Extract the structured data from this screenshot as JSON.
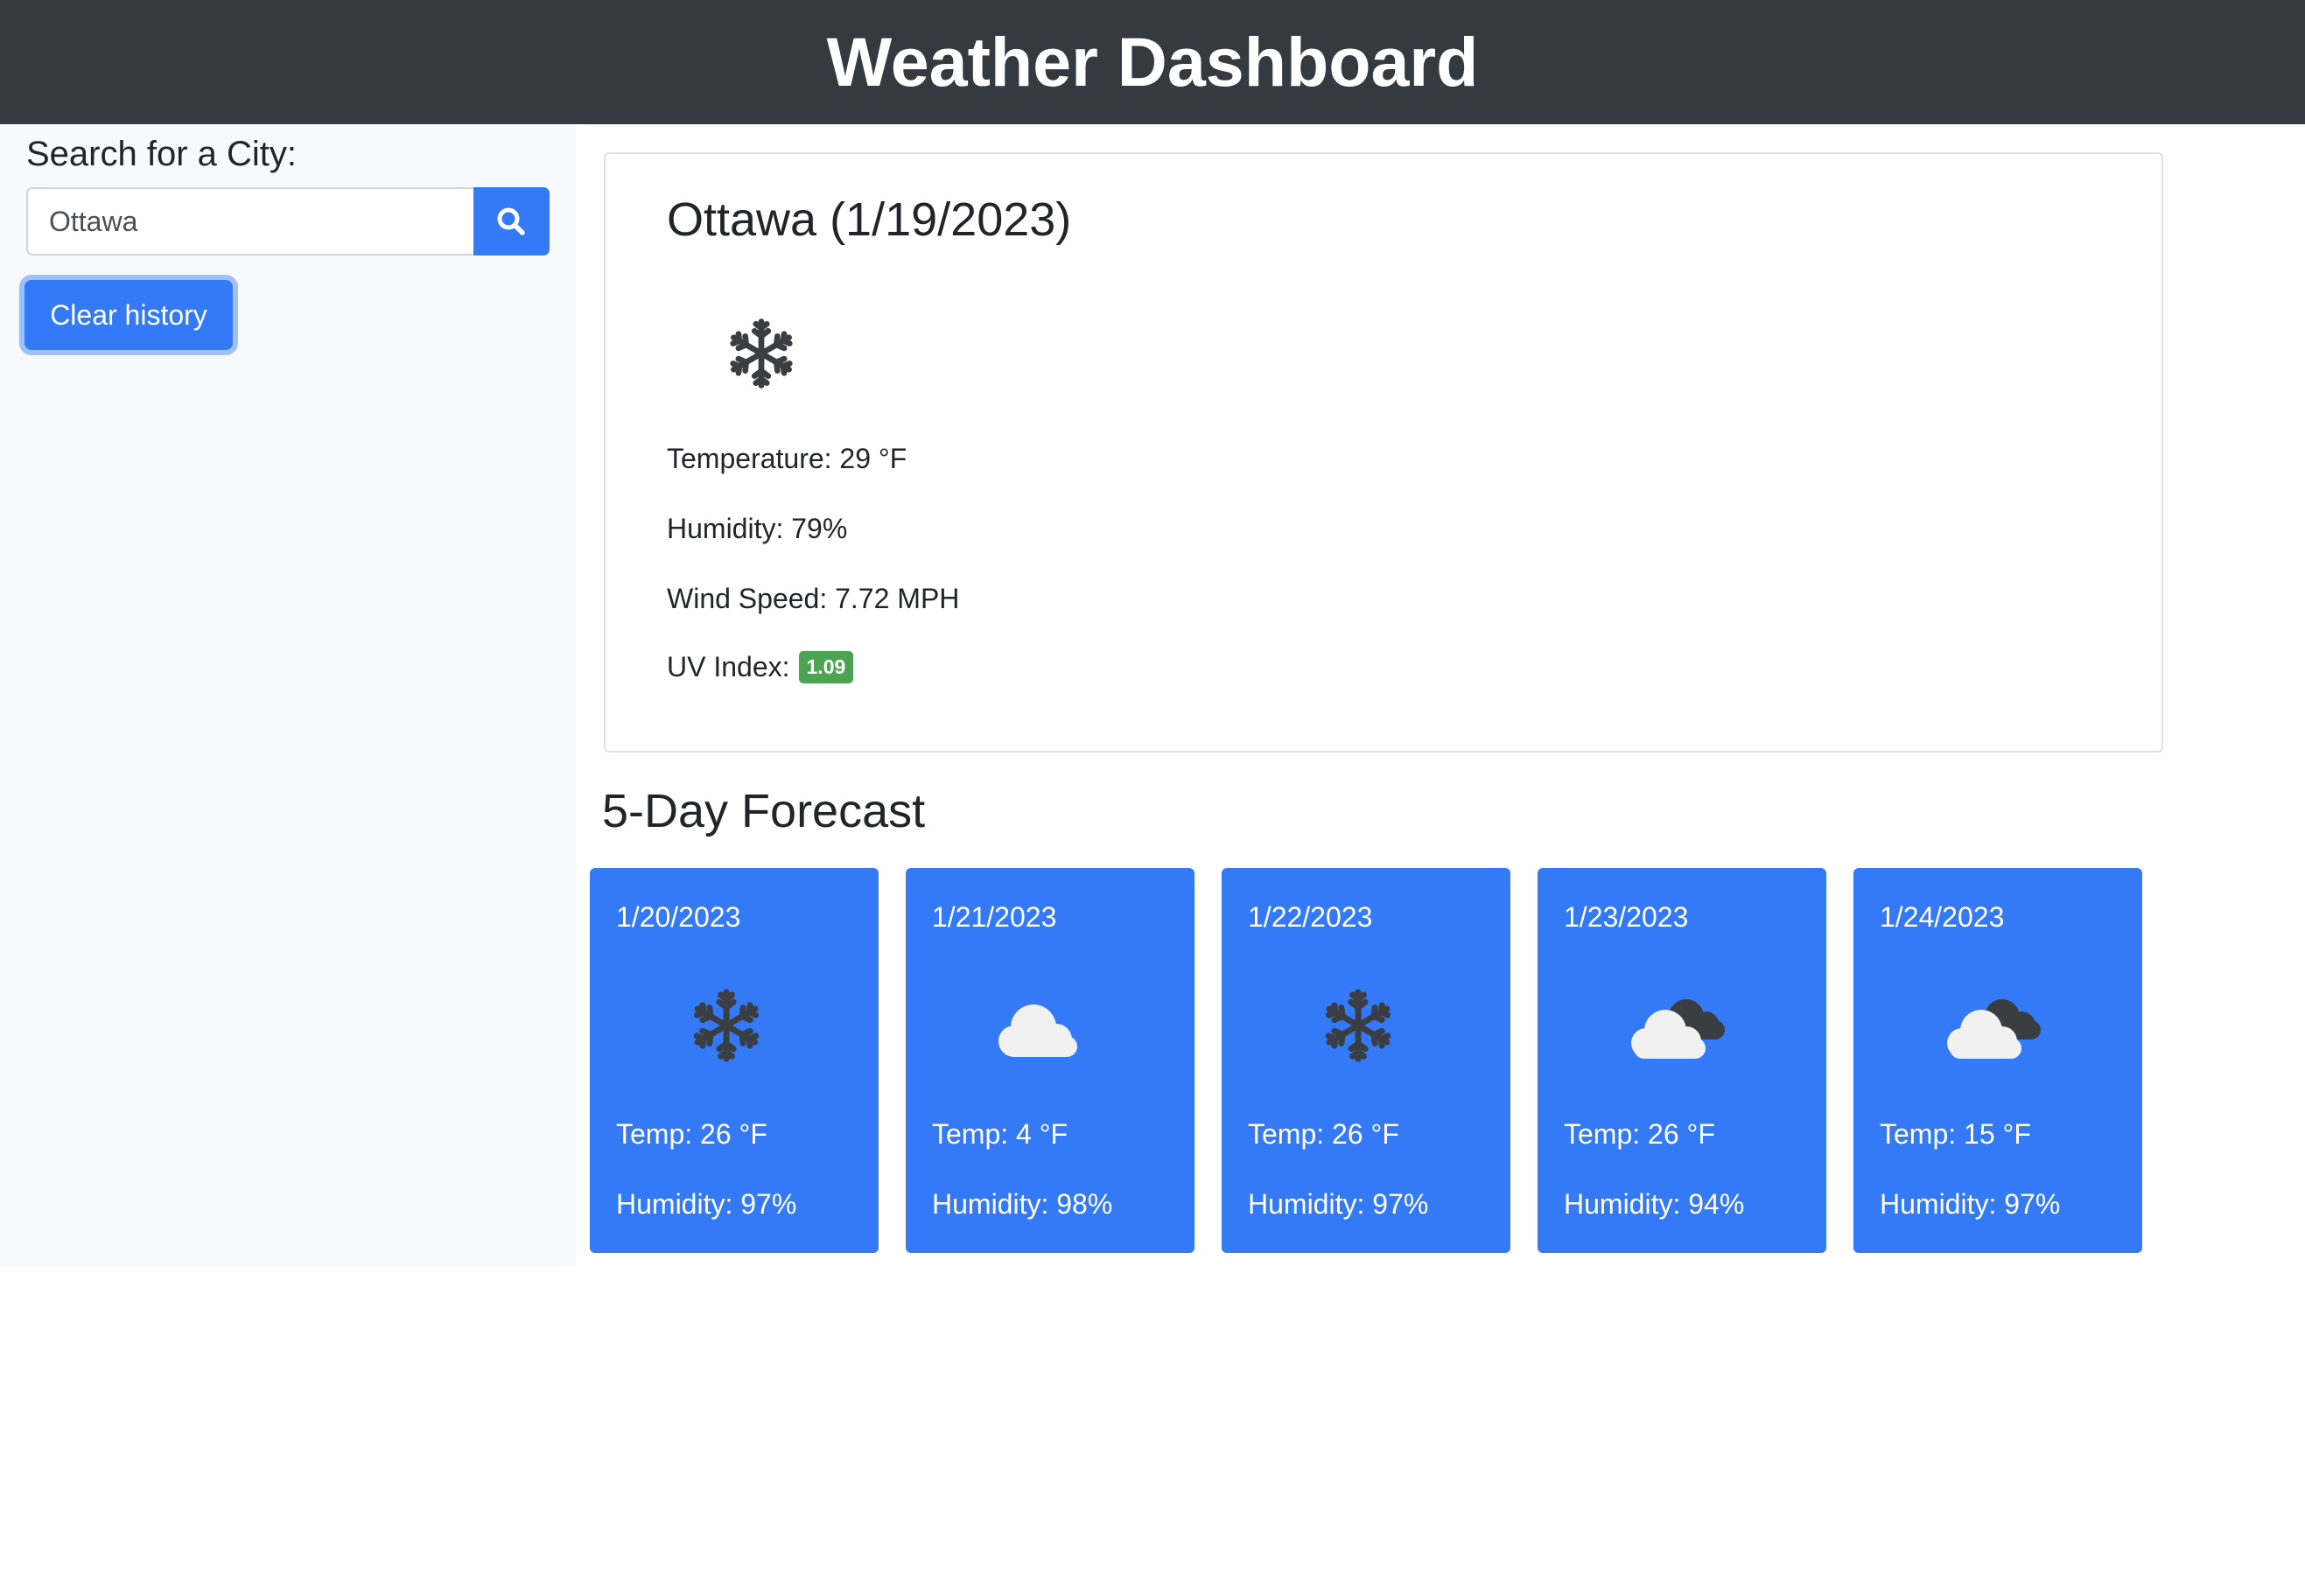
{
  "header": {
    "title": "Weather Dashboard"
  },
  "sidebar": {
    "search_label": "Search for a City:",
    "search_value": "Ottawa",
    "search_icon": "search-icon",
    "clear_label": "Clear history"
  },
  "current": {
    "title": "Ottawa (1/19/2023)",
    "icon": "snowflake-icon",
    "temperature": "Temperature: 29 °F",
    "humidity": "Humidity: 79%",
    "wind": "Wind Speed: 7.72 MPH",
    "uv_label": "UV Index:",
    "uv_value": "1.09",
    "uv_color": "#4ca352"
  },
  "forecast": {
    "title": "5-Day Forecast",
    "accent": "#3479f6",
    "days": [
      {
        "date": "1/20/2023",
        "icon": "snowflake-icon",
        "temp": "Temp: 26 °F",
        "humidity": "Humidity: 97%"
      },
      {
        "date": "1/21/2023",
        "icon": "cloud-icon",
        "temp": "Temp: 4 °F",
        "humidity": "Humidity: 98%"
      },
      {
        "date": "1/22/2023",
        "icon": "snowflake-icon",
        "temp": "Temp: 26 °F",
        "humidity": "Humidity: 97%"
      },
      {
        "date": "1/23/2023",
        "icon": "broken-clouds-icon",
        "temp": "Temp: 26 °F",
        "humidity": "Humidity: 94%"
      },
      {
        "date": "1/24/2023",
        "icon": "broken-clouds-icon",
        "temp": "Temp: 15 °F",
        "humidity": "Humidity: 97%"
      }
    ]
  }
}
